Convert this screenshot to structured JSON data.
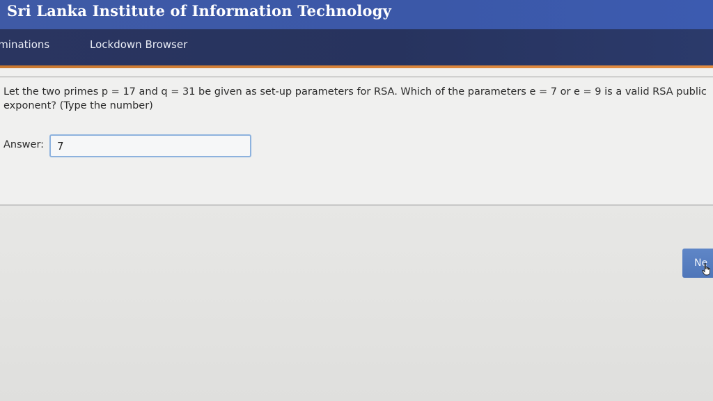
{
  "header": {
    "title": "Sri Lanka Institute of Information Technology"
  },
  "nav": {
    "items": [
      {
        "label": "aminations"
      },
      {
        "label": "Lockdown Browser"
      }
    ]
  },
  "question": {
    "text": "Let the two primes p = 17 and q = 31 be given as set-up parameters for RSA. Which of the parameters e = 7 or e = 9 is a valid RSA public exponent? (Type the number)",
    "answer_label": "Answer:",
    "answer_value": "7"
  },
  "footer": {
    "next_label": "Ne"
  },
  "colors": {
    "brand_bar": "#3f5aa6",
    "nav_bar": "#2a3560",
    "accent": "#d9843a",
    "input_border": "#8db2de",
    "next_button": "#5a80c2"
  },
  "icons": {
    "cursor": "hand-pointer-icon"
  }
}
